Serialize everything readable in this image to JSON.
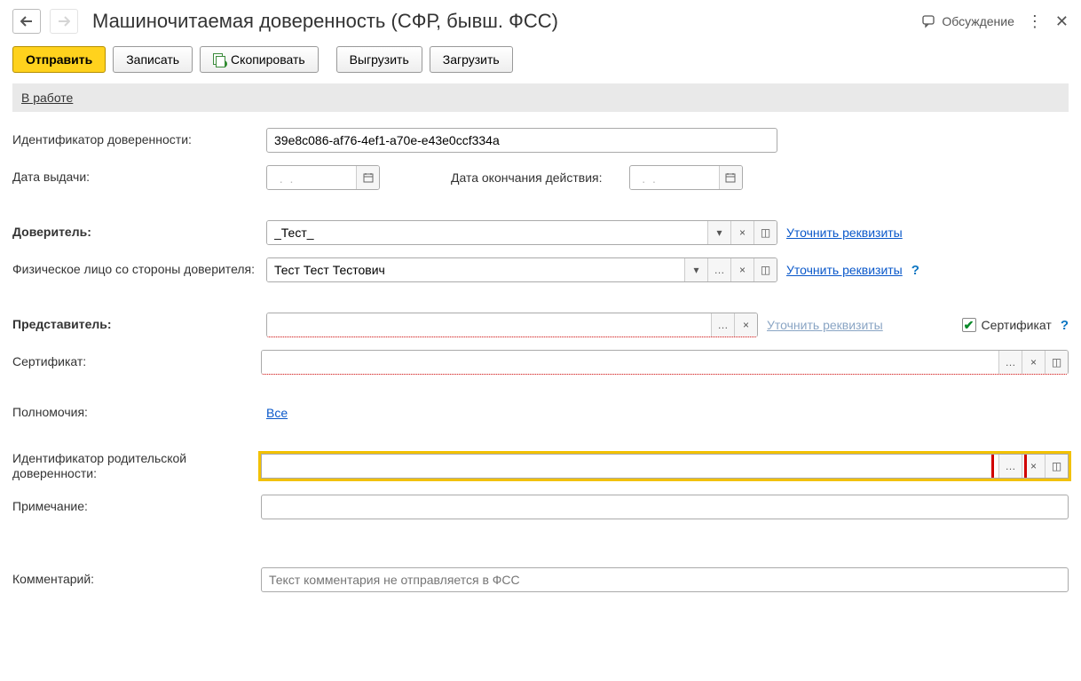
{
  "titlebar": {
    "title": "Машиночитаемая доверенность (СФР, бывш. ФСС)",
    "discuss": "Обсуждение"
  },
  "toolbar": {
    "send": "Отправить",
    "save": "Записать",
    "copy": "Скопировать",
    "export": "Выгрузить",
    "import": "Загрузить"
  },
  "status": {
    "label": "В работе"
  },
  "labels": {
    "id": "Идентификатор доверенности:",
    "issue_date": "Дата выдачи:",
    "end_date": "Дата окончания действия:",
    "principal": "Доверитель:",
    "principal_person": "Физическое лицо со стороны доверителя:",
    "representative": "Представитель:",
    "certificate": "Сертификат:",
    "powers": "Полномочия:",
    "parent_id": "Идентификатор родительской доверенности:",
    "note": "Примечание:",
    "comment": "Комментарий:"
  },
  "values": {
    "id": "39e8c086-af76-4ef1-a70e-e43e0ccf334a",
    "issue_date": "  .  .    ",
    "end_date": "  .  .    ",
    "principal": "_Тест_",
    "principal_person": "Тест Тест Тестович",
    "representative": "",
    "certificate": "",
    "parent_id": "",
    "note": "",
    "comment": ""
  },
  "links": {
    "clarify": "Уточнить реквизиты",
    "powers_all": "Все"
  },
  "checkbox": {
    "cert": "Сертификат"
  },
  "placeholders": {
    "comment": "Текст комментария не отправляется в ФСС"
  },
  "icons": {
    "dropdown": "▾",
    "clear": "×",
    "open": "◫",
    "dots": "…",
    "calendar": "☷",
    "check": "✔"
  }
}
